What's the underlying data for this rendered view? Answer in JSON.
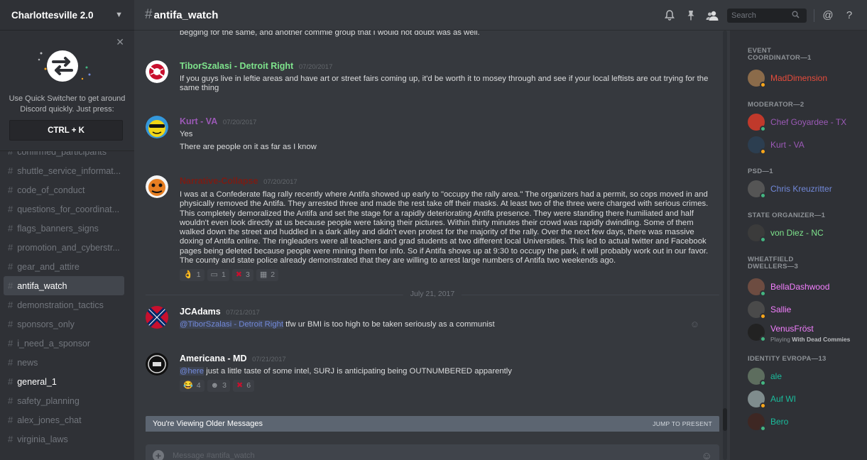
{
  "server": {
    "name": "Charlottesville 2.0"
  },
  "quick_switcher": {
    "text": "Use Quick Switcher to get around Discord quickly. Just press:",
    "shortcut": "CTRL + K"
  },
  "channels": [
    {
      "name": "confirmed_participants",
      "state": "muted"
    },
    {
      "name": "shuttle_service_informat...",
      "state": "muted"
    },
    {
      "name": "code_of_conduct",
      "state": "muted"
    },
    {
      "name": "questions_for_coordinat...",
      "state": "muted"
    },
    {
      "name": "flags_banners_signs",
      "state": "muted"
    },
    {
      "name": "promotion_and_cyberstr...",
      "state": "muted"
    },
    {
      "name": "gear_and_attire",
      "state": "muted"
    },
    {
      "name": "antifa_watch",
      "state": "active"
    },
    {
      "name": "demonstration_tactics",
      "state": "muted"
    },
    {
      "name": "sponsors_only",
      "state": "muted"
    },
    {
      "name": "i_need_a_sponsor",
      "state": "muted"
    },
    {
      "name": "news",
      "state": "muted"
    },
    {
      "name": "general_1",
      "state": "unread"
    },
    {
      "name": "safety_planning",
      "state": "muted"
    },
    {
      "name": "alex_jones_chat",
      "state": "muted"
    },
    {
      "name": "virginia_laws",
      "state": "muted"
    }
  ],
  "header": {
    "channel_name": "antifa_watch",
    "search_placeholder": "Search",
    "icons": [
      "bell-icon",
      "pin-icon",
      "members-icon",
      "search-icon",
      "mention-icon",
      "help-icon"
    ]
  },
  "messages": {
    "top_fragment": "begging for the same, and another commie group that I would not doubt was as well.",
    "items": [
      {
        "author": "TiborSzalasi - Detroit Right",
        "author_color": "#7ee38c",
        "timestamp": "07/20/2017",
        "lines": [
          "If you guys live in leftie areas and have art or street fairs coming up, it'd be worth it to mosey through and see if your local leftists are out trying for the same thing"
        ]
      },
      {
        "author": "Kurt - VA",
        "author_color": "#9b59b6",
        "timestamp": "07/20/2017",
        "lines": [
          "Yes",
          "There are people on it as far as I know"
        ]
      },
      {
        "author": "Narrative-Collapse",
        "author_color": "#7a1c14",
        "timestamp": "07/20/2017",
        "lines": [
          "I was at a Confederate flag rally recently where Antifa showed up early to \"occupy the rally area.\" The organizers had a permit, so cops moved in and physically removed the Antifa. They arrested three and made the rest take off their masks. At least two of the three were charged with serious crimes. This completely demoralized the Antifa and set the stage for a rapidly deteriorating Antifa presence. They were standing there humiliated and half wouldn't even look directly at us because people were taking their pictures. Within thirty minutes their crowd was rapidly dwindling. Some of them walked down the street and huddled in a dark alley and didn't even protest for the majority of the rally. Over the next few days, there was massive doxing of Antifa online. The ringleaders were all teachers and grad students at two different local Universities. This led to actual twitter and Facebook pages being deleted because people were mining them for info. So if Antifa shows up at 9:30 to occupy the park, it will probably work out in our favor. The county and state police already demonstrated that they are willing to arrest large numbers of Antifa two weekends ago."
        ],
        "reactions": [
          {
            "emoji": "👌",
            "count": "1"
          },
          {
            "emoji": "▭",
            "count": "1"
          },
          {
            "emoji": "✖",
            "count": "3"
          },
          {
            "emoji": "▦",
            "count": "2"
          }
        ]
      },
      {
        "author": "JCAdams",
        "author_color": "#ffffff",
        "timestamp": "07/21/2017",
        "mention": "@TiborSzalasi - Detroit Right",
        "text_after_mention": " tfw ur BMI is too high to be taken seriously as a communist"
      },
      {
        "author": "Americana - MD",
        "author_color": "#ffffff",
        "timestamp": "07/21/2017",
        "mention": "@here",
        "text_after_mention": " just a little taste of some intel, SURJ is anticipating being OUTNUMBERED apparently",
        "reactions": [
          {
            "emoji": "😂",
            "count": "4"
          },
          {
            "emoji": "☻",
            "count": "3"
          },
          {
            "emoji": "✖",
            "count": "6"
          }
        ]
      }
    ],
    "date_divider": "July 21, 2017",
    "older_banner": "You're Viewing Older Messages",
    "jump_label": "JUMP TO PRESENT",
    "composer_placeholder": "Message #antifa_watch"
  },
  "members": {
    "groups": [
      {
        "role": "EVENT COORDINATOR—1",
        "members": [
          {
            "name": "MadDimension",
            "color": "#e74c3c",
            "status": "#faa61a"
          }
        ]
      },
      {
        "role": "MODERATOR—2",
        "members": [
          {
            "name": "Chef Goyardee - TX",
            "color": "#9b59b6",
            "status": "#43b581"
          },
          {
            "name": "Kurt - VA",
            "color": "#9b59b6",
            "status": "#faa61a"
          }
        ]
      },
      {
        "role": "PSD—1",
        "members": [
          {
            "name": "Chris Kreuzritter",
            "color": "#7289da",
            "status": "#43b581"
          }
        ]
      },
      {
        "role": "STATE ORGANIZER—1",
        "members": [
          {
            "name": "von Diez - NC",
            "color": "#7ee38c",
            "status": "#43b581"
          }
        ]
      },
      {
        "role": "WHEATFIELD DWELLERS—3",
        "members": [
          {
            "name": "BellaDashwood",
            "color": "#f47fff",
            "status": "#43b581"
          },
          {
            "name": "Sallie",
            "color": "#f47fff",
            "status": "#faa61a"
          },
          {
            "name": "VenusFröst",
            "color": "#f47fff",
            "status": "#43b581",
            "playing": "Playing",
            "game": "With Dead Commies"
          }
        ]
      },
      {
        "role": "IDENTITY EVROPA—13",
        "members": [
          {
            "name": "ale",
            "color": "#1abc9c",
            "status": "#43b581"
          },
          {
            "name": "Auf WI",
            "color": "#1abc9c",
            "status": "#faa61a"
          },
          {
            "name": "Bero",
            "color": "#1abc9c",
            "status": "#43b581"
          }
        ]
      }
    ]
  }
}
